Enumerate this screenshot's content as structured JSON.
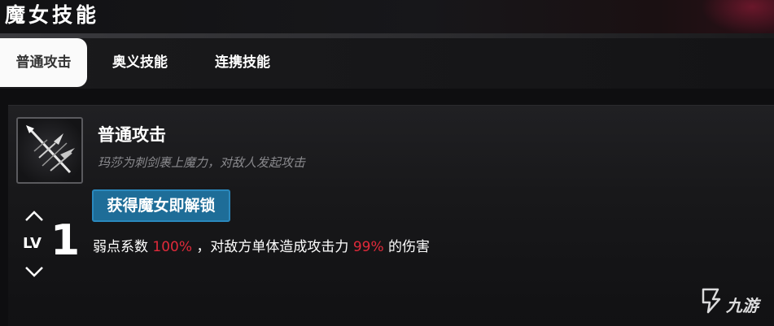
{
  "header": {
    "title": "魔女技能"
  },
  "tabs": [
    {
      "label": "普通攻击",
      "active": true
    },
    {
      "label": "奥义技能",
      "active": false
    },
    {
      "label": "连携技能",
      "active": false
    }
  ],
  "skill": {
    "icon": "sword-slash-icon",
    "name": "普通攻击",
    "description": "玛莎为刺剑裹上魔力，对敌人发起攻击",
    "unlock_badge": "获得魔女即解锁",
    "level_label": "LV",
    "level_value": "1",
    "effect": {
      "part1": "弱点系数 ",
      "value1": "100%",
      "part2": " ，对敌方单体造成攻击力 ",
      "value2": "99%",
      "part3": " 的伤害"
    }
  },
  "watermark": {
    "text": "九游"
  },
  "colors": {
    "highlight": "#e02a3a",
    "badge": "#1e6d98",
    "active_tab_bg": "#fafafa"
  }
}
